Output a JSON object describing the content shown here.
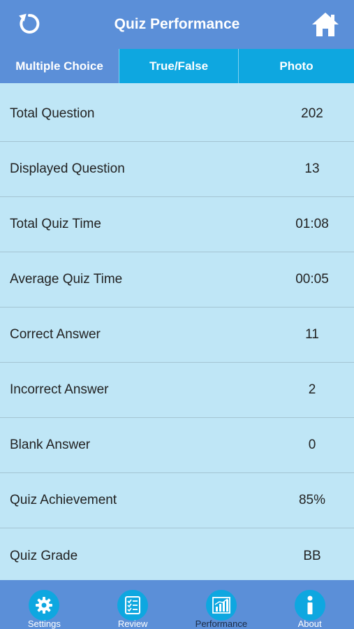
{
  "header": {
    "title": "Quiz Performance",
    "back_icon": "refresh-back-icon",
    "home_icon": "home-icon"
  },
  "tabs": [
    {
      "label": "Multiple Choice",
      "selected": true
    },
    {
      "label": "True/False",
      "selected": false
    },
    {
      "label": "Photo",
      "selected": false
    }
  ],
  "stats": [
    {
      "label": "Total Question",
      "value": "202"
    },
    {
      "label": "Displayed Question",
      "value": "13"
    },
    {
      "label": "Total Quiz Time",
      "value": "01:08"
    },
    {
      "label": "Average Quiz Time",
      "value": "00:05"
    },
    {
      "label": "Correct Answer",
      "value": "11"
    },
    {
      "label": "Incorrect Answer",
      "value": "2"
    },
    {
      "label": "Blank Answer",
      "value": "0"
    },
    {
      "label": "Quiz Achievement",
      "value": "85%"
    },
    {
      "label": "Quiz Grade",
      "value": "BB"
    }
  ],
  "nav": [
    {
      "label": "Settings",
      "icon": "gear-icon"
    },
    {
      "label": "Review",
      "icon": "checklist-icon"
    },
    {
      "label": "Performance",
      "icon": "bar-chart-icon",
      "active": true
    },
    {
      "label": "About",
      "icon": "info-icon"
    }
  ],
  "colors": {
    "header": "#5b8fd8",
    "tab_active": "#5b8fd8",
    "tab_inactive": "#0ea7e0",
    "content_bg": "#bfe6f6",
    "nav_icon_bg": "#0ea7e0"
  }
}
